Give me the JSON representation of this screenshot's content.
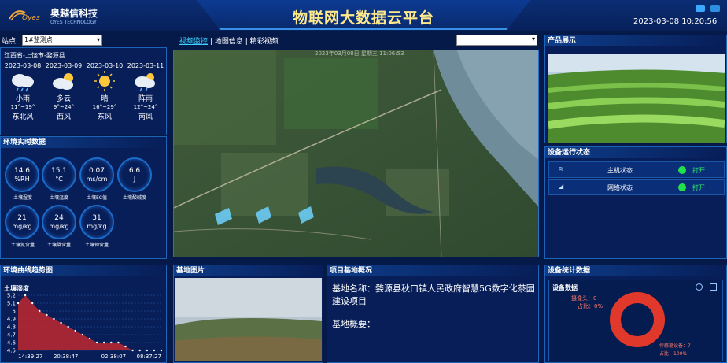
{
  "header": {
    "brand_cn": "奥越信科技",
    "brand_en": "OYES TECHNOLOGY",
    "logo_word": "Oyes",
    "title": "物联网大数据云平台",
    "datetime": "2023-03-08 10:20:56"
  },
  "station": {
    "label": "站点",
    "selected": "1#监测点"
  },
  "weather": {
    "region": "江西省-上饶市-婺源县",
    "days": [
      {
        "date": "2023-03-08",
        "icon": "rain-cloud-icon",
        "desc": "小雨",
        "temp": "11°~19°",
        "wind": "东北风"
      },
      {
        "date": "2023-03-09",
        "icon": "partly-cloudy-icon",
        "desc": "多云",
        "temp": "9°~24°",
        "wind": "西风"
      },
      {
        "date": "2023-03-10",
        "icon": "sun-icon",
        "desc": "晴",
        "temp": "16°~29°",
        "wind": "东风"
      },
      {
        "date": "2023-03-11",
        "icon": "shower-icon",
        "desc": "阵雨",
        "temp": "12°~24°",
        "wind": "南风"
      }
    ]
  },
  "env": {
    "title": "环境实时数据",
    "gauges": [
      {
        "value": "14.6",
        "unit": "%RH",
        "label": "土壤湿度"
      },
      {
        "value": "15.1",
        "unit": "°C",
        "label": "土壤温度"
      },
      {
        "value": "0.07",
        "unit": "ms/cm",
        "label": "土壤EC值"
      },
      {
        "value": "6.6",
        "unit": "J",
        "label": "土壤酸碱度"
      },
      {
        "value": "21",
        "unit": "mg/kg",
        "label": "土壤氮含量"
      },
      {
        "value": "24",
        "unit": "mg/kg",
        "label": "土壤磷含量"
      },
      {
        "value": "31",
        "unit": "mg/kg",
        "label": "土壤钾含量"
      }
    ]
  },
  "trend": {
    "title": "环境曲线趋势图",
    "chart_title": "土壤湿度"
  },
  "chart_data": {
    "type": "area",
    "title": "土壤湿度",
    "x_ticks": [
      "14:39:27",
      "20:38:47",
      "02:38:07",
      "08:37:27"
    ],
    "y_ticks": [
      4.5,
      4.6,
      4.7,
      4.8,
      4.9,
      5,
      5.1,
      5.2
    ],
    "ylim": [
      4.5,
      5.2
    ],
    "values": [
      5.1,
      5.2,
      5.1,
      5.0,
      4.95,
      4.9,
      4.85,
      4.8,
      4.75,
      4.7,
      4.65,
      4.6,
      4.6,
      4.6,
      4.6,
      4.55,
      4.5,
      4.5,
      4.5,
      4.5,
      4.5
    ],
    "color": "#c0282e"
  },
  "map": {
    "tabs": [
      "视频监控",
      "地图信息",
      "精彩视频"
    ],
    "active_tab": 0,
    "separator": "|",
    "watermark": "2023年03月08日 星期三 11:06:53"
  },
  "basephoto": {
    "title": "基地图片"
  },
  "project": {
    "title": "项目基地概况",
    "name": "基地名称：婺源县秋口镇人民政府智慧5G数字化茶园建设项目",
    "overview": "基地概要："
  },
  "product": {
    "title": "产品展示"
  },
  "status": {
    "title": "设备运行状态",
    "rows": [
      {
        "icon": "wifi-icon",
        "name": "主机状态",
        "state": "打开"
      },
      {
        "icon": "signal-icon",
        "name": "网络状态",
        "state": "打开"
      }
    ]
  },
  "stats": {
    "title": "设备统计数据",
    "inner_title": "设备数据",
    "legend": [
      {
        "label": "摄像头：0",
        "pct": "占比：0%"
      },
      {
        "label": "传感器设备：7",
        "pct": "占比：100%"
      }
    ],
    "ring_color": "#e0392b"
  }
}
